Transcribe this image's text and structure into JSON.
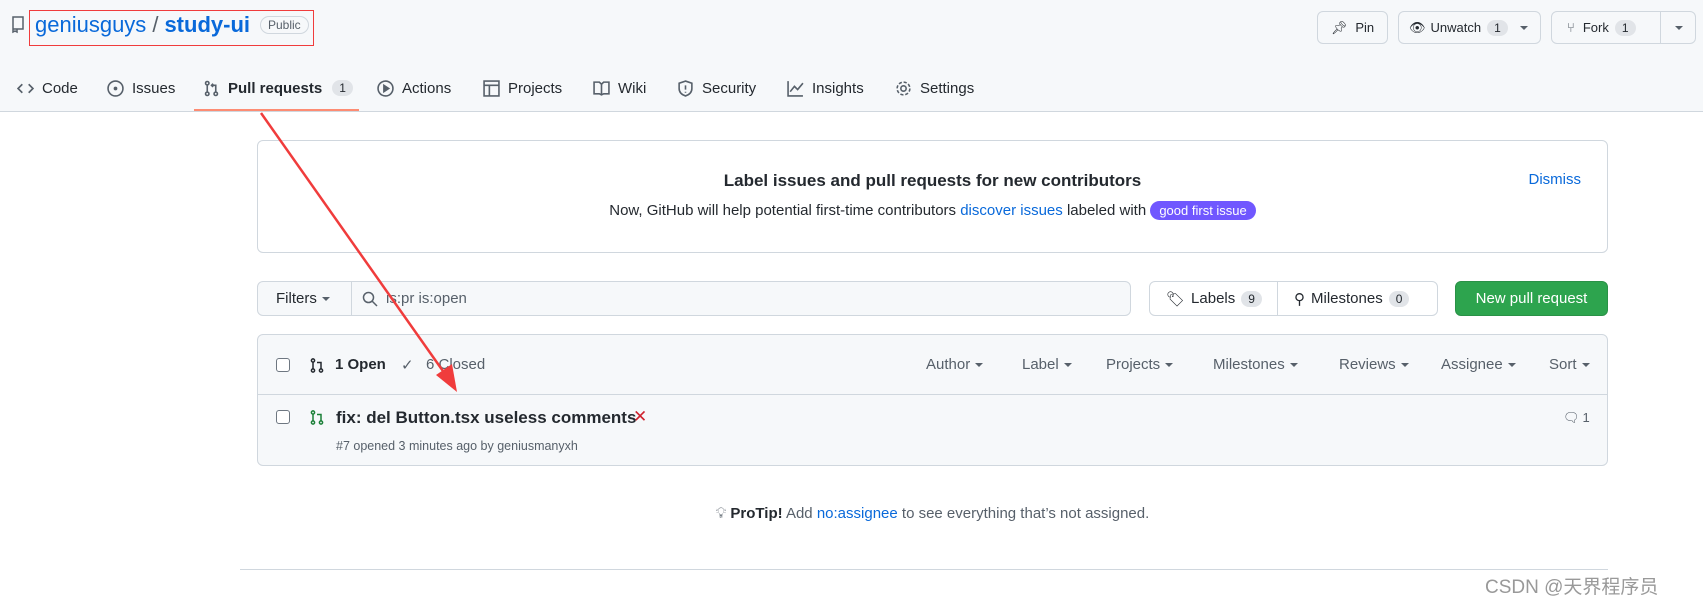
{
  "repo": {
    "owner": "geniusguys",
    "separator": "/",
    "name": "study-ui",
    "visibility": "Public"
  },
  "actions": {
    "pin": "Pin",
    "unwatch": "Unwatch",
    "unwatch_count": "1",
    "fork": "Fork",
    "fork_count": "1"
  },
  "tabs": [
    {
      "label": "Code",
      "icon": "code-icon"
    },
    {
      "label": "Issues",
      "icon": "issue-icon"
    },
    {
      "label": "Pull requests",
      "icon": "pull-request-icon",
      "count": "1",
      "active": true
    },
    {
      "label": "Actions",
      "icon": "play-icon"
    },
    {
      "label": "Projects",
      "icon": "table-icon"
    },
    {
      "label": "Wiki",
      "icon": "book-icon"
    },
    {
      "label": "Security",
      "icon": "shield-icon"
    },
    {
      "label": "Insights",
      "icon": "graph-icon"
    },
    {
      "label": "Settings",
      "icon": "gear-icon"
    }
  ],
  "banner": {
    "title": "Label issues and pull requests for new contributors",
    "text_before": "Now, GitHub will help potential first-time contributors",
    "link": "discover issues",
    "text_after": "labeled with",
    "label": "good first issue",
    "label_color": "#7057ff",
    "dismiss": "Dismiss"
  },
  "filter": {
    "filters_label": "Filters",
    "search_value": "is:pr is:open",
    "labels": "Labels",
    "labels_count": "9",
    "milestones": "Milestones",
    "milestones_count": "0",
    "new_pr": "New pull request",
    "new_pr_color": "#2da44e"
  },
  "list": {
    "open": "1 Open",
    "closed": "6 Closed",
    "filters": [
      "Author",
      "Label",
      "Projects",
      "Milestones",
      "Reviews",
      "Assignee",
      "Sort"
    ],
    "items": [
      {
        "title": "fix: del Button.tsx useless comments",
        "status": "✕",
        "meta": "#7 opened 3 minutes ago by geniusmanyxh",
        "comments": "1"
      }
    ]
  },
  "protip": {
    "bold": "ProTip!",
    "before": "Add",
    "link": "no:assignee",
    "after": "to see everything that’s not assigned."
  },
  "watermark": "CSDN @天界程序员",
  "annotation_color": "#f03c3c"
}
